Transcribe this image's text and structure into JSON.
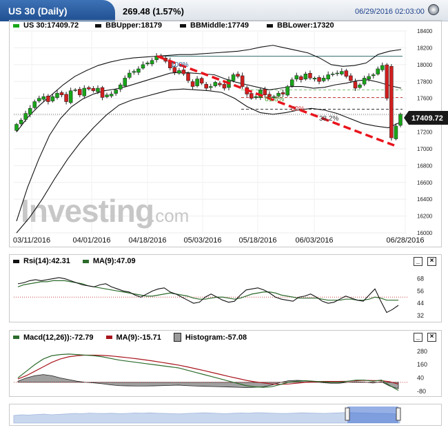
{
  "header": {
    "title": "US 30 (Daily)",
    "last": "269.48 (1.57%)",
    "datetime": "06/29/2016 02:03:00"
  },
  "colors": {
    "bull": "#19a61a",
    "bear": "#d11f1f",
    "trend": "#e8141c",
    "ma": "#2c6b2c",
    "signal": "#a8141c",
    "macd": "#2c6b2c"
  },
  "main": {
    "legend": {
      "symbol": "US 30:17409.72",
      "bb_upper": "BBUpper:18179",
      "bb_middle": "BBMiddle:17749",
      "bb_lower": "BBLower:17320"
    },
    "price_tag": "17409.72",
    "fib": {
      "f100": "100%",
      "f618": "61.8%",
      "f50": "50%",
      "f382": "38.2%"
    },
    "watermark": "Investing",
    "watermark_suffix": ".com"
  },
  "rsi": {
    "label": "Rsi(14):42.31",
    "ma_label": "MA(9):47.09"
  },
  "macd": {
    "label": "Macd(12,26)):-72.79",
    "ma_label": "MA(9):-15.71",
    "hist_label": "Histogram:-57.08"
  },
  "panel_buttons": {
    "minimize": "_",
    "close": "×"
  },
  "chart_data": [
    {
      "type": "candlestick",
      "title": "US 30 (Daily)",
      "x_ticks": [
        "03/11/2016",
        "04/01/2016",
        "04/18/2016",
        "05/03/2016",
        "05/18/2016",
        "06/03/2016",
        "06/28/2016"
      ],
      "y_ticks": [
        16000,
        16200,
        16400,
        16600,
        16800,
        17000,
        17200,
        17400,
        17600,
        17800,
        18000,
        18200,
        18400
      ],
      "ylim": [
        16000,
        18400
      ],
      "series": [
        {
          "name": "US 30",
          "close": [
            17290,
            17340,
            17420,
            17480,
            17560,
            17600,
            17620,
            17560,
            17620,
            17660,
            17640,
            17560,
            17690,
            17700,
            17640,
            17720,
            17710,
            17690,
            17720,
            17610,
            17640,
            17650,
            17700,
            17760,
            17840,
            17900,
            17920,
            17950,
            18000,
            18020,
            18050,
            18100,
            18090,
            18040,
            17960,
            17910,
            17930,
            17890,
            17810,
            17740,
            17830,
            17780,
            17720,
            17740,
            17790,
            17760,
            17720,
            17820,
            17880,
            17860,
            17740,
            17650,
            17600,
            17620,
            17700,
            17640,
            17620,
            17620,
            17660,
            17650,
            17740,
            17820,
            17870,
            17820,
            17890,
            17840,
            17840,
            17800,
            17840,
            17880,
            17890,
            17900,
            17920,
            17860,
            17810,
            17720,
            17760,
            17840,
            17860,
            17880,
            17950,
            17990,
            17600,
            17130,
            17270,
            17410
          ]
        }
      ],
      "bb_upper": [
        17200,
        17380,
        17520,
        17640,
        17760,
        17860,
        17930,
        17990,
        18030,
        18060,
        18080,
        18090,
        18100,
        18110,
        18120,
        18120,
        18130,
        18140,
        18150,
        18160,
        18180,
        18210,
        18230,
        18200,
        18170,
        18140,
        18080,
        18000,
        17980,
        17990,
        18020,
        18120,
        18160,
        18180
      ],
      "bb_middle": [
        16140,
        16540,
        16870,
        17160,
        17360,
        17500,
        17590,
        17650,
        17690,
        17710,
        17740,
        17780,
        17820,
        17860,
        17900,
        17910,
        17900,
        17890,
        17880,
        17830,
        17790,
        17760,
        17730,
        17700,
        17720,
        17740,
        17740,
        17720,
        17730,
        17760,
        17780,
        17810,
        17820,
        17790,
        17750,
        17720
      ],
      "bb_lower": [
        16000,
        16180,
        16400,
        16650,
        16880,
        17080,
        17250,
        17400,
        17520,
        17580,
        17620,
        17660,
        17700,
        17710,
        17700,
        17690,
        17670,
        17600,
        17500,
        17430,
        17410,
        17430,
        17460,
        17480,
        17460,
        17420,
        17360,
        17300,
        17270,
        17250,
        17320
      ],
      "horizontal_levels": [
        18100,
        17610,
        17470,
        17410
      ],
      "trendlines": [
        {
          "from": [
            18100,
            "04/18/2016"
          ],
          "to": [
            17040,
            "06/28/2016"
          ]
        }
      ]
    },
    {
      "type": "line",
      "title": "Rsi(14)",
      "y_ticks": [
        32,
        44,
        56,
        68
      ],
      "ylim": [
        30,
        75
      ],
      "series": [
        {
          "name": "Rsi(14)",
          "values": [
            63,
            64,
            66,
            67,
            66,
            67,
            68,
            69,
            68,
            66,
            64,
            62,
            61,
            60,
            62,
            63,
            60,
            58,
            56,
            55,
            52,
            50,
            53,
            56,
            58,
            59,
            55,
            53,
            50,
            47,
            44,
            45,
            50,
            53,
            50,
            47,
            45,
            46,
            52,
            57,
            58,
            59,
            57,
            54,
            50,
            48,
            47,
            46,
            50,
            51,
            53,
            50,
            46,
            44,
            45,
            48,
            51,
            49,
            47,
            46,
            52,
            58,
            46,
            35,
            38,
            42
          ]
        },
        {
          "name": "MA(9)",
          "values": [
            60,
            62,
            63,
            64,
            65,
            65,
            66,
            66,
            66,
            65,
            64,
            63,
            61,
            60,
            59,
            58,
            57,
            56,
            55,
            54,
            53,
            52,
            51,
            51,
            52,
            53,
            54,
            53,
            52,
            51,
            49,
            48,
            48,
            49,
            50,
            50,
            49,
            48,
            49,
            51,
            53,
            54,
            55,
            55,
            54,
            52,
            51,
            50,
            49,
            49,
            49,
            49,
            48,
            47,
            47,
            47,
            48,
            48,
            47,
            47,
            48,
            50,
            49,
            47,
            47,
            47
          ]
        }
      ],
      "reference_line": 50
    },
    {
      "type": "line",
      "title": "Macd(12,26)",
      "y_ticks": [
        -80,
        40,
        160,
        280
      ],
      "ylim": [
        -100,
        310
      ],
      "series": [
        {
          "name": "Macd(12,26)",
          "values": [
            40,
            100,
            160,
            210,
            240,
            250,
            255,
            250,
            245,
            240,
            230,
            215,
            200,
            190,
            180,
            170,
            160,
            150,
            140,
            130,
            110,
            90,
            70,
            50,
            30,
            10,
            -10,
            -30,
            -40,
            -45,
            -40,
            -20,
            0,
            10,
            15,
            10,
            5,
            0,
            0,
            10,
            20,
            20,
            10,
            20,
            -30,
            -73
          ]
        },
        {
          "name": "MA(9)",
          "values": [
            30,
            60,
            100,
            140,
            180,
            210,
            230,
            240,
            245,
            245,
            243,
            238,
            230,
            222,
            213,
            203,
            192,
            180,
            168,
            155,
            140,
            123,
            106,
            88,
            70,
            52,
            35,
            18,
            5,
            -5,
            -15,
            -18,
            -15,
            -8,
            0,
            5,
            8,
            8,
            8,
            10,
            15,
            18,
            16,
            15,
            5,
            -16
          ]
        },
        {
          "name": "Histogram",
          "values": [
            10,
            40,
            60,
            70,
            60,
            40,
            25,
            10,
            0,
            -5,
            -13,
            -23,
            -30,
            -32,
            -33,
            -33,
            -32,
            -30,
            -28,
            -25,
            -30,
            -33,
            -36,
            -38,
            -40,
            -42,
            -45,
            -48,
            -45,
            -40,
            -25,
            -2,
            15,
            18,
            15,
            5,
            -3,
            -8,
            -8,
            0,
            5,
            2,
            -6,
            5,
            -35,
            -57
          ]
        }
      ],
      "reference_line": 0
    }
  ]
}
